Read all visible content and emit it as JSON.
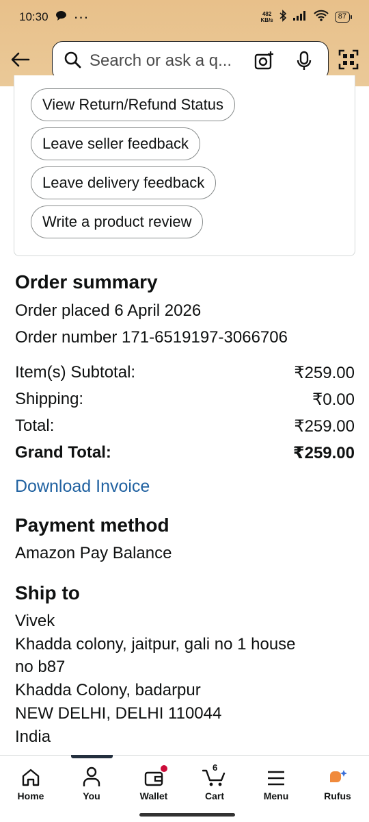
{
  "status_bar": {
    "time": "10:30",
    "dots": "···",
    "net_speed_value": "482",
    "net_speed_unit": "KB/s",
    "battery": "87"
  },
  "search": {
    "placeholder": "Search or ask a q..."
  },
  "actions": [
    {
      "label": "View Return/Refund Status"
    },
    {
      "label": "Leave seller feedback"
    },
    {
      "label": "Leave delivery feedback"
    },
    {
      "label": "Write a product review"
    }
  ],
  "order_summary": {
    "title": "Order summary",
    "placed": "Order placed 6 April 2026",
    "number": "Order number 171-6519197-3066706",
    "rows": [
      {
        "label": "Item(s) Subtotal:",
        "value": "₹259.00"
      },
      {
        "label": "Shipping:",
        "value": "₹0.00"
      },
      {
        "label": "Total:",
        "value": "₹259.00"
      },
      {
        "label": "Grand Total:",
        "value": "₹259.00"
      }
    ],
    "invoice_link": "Download Invoice"
  },
  "payment": {
    "title": "Payment method",
    "method": "Amazon Pay Balance"
  },
  "ship_to": {
    "title": "Ship to",
    "lines": [
      "Vivek",
      "Khadda colony, jaitpur, gali no 1 house",
      "no b87",
      "Khadda Colony, badarpur",
      "NEW DELHI, DELHI 110044",
      "India"
    ]
  },
  "bottom_nav": {
    "cart_count": "6",
    "items": [
      {
        "label": "Home",
        "icon": "home-icon"
      },
      {
        "label": "You",
        "icon": "user-icon"
      },
      {
        "label": "Wallet",
        "icon": "wallet-icon"
      },
      {
        "label": "Cart",
        "icon": "cart-icon"
      },
      {
        "label": "Menu",
        "icon": "menu-icon"
      },
      {
        "label": "Rufus",
        "icon": "rufus-icon"
      }
    ]
  },
  "colors": {
    "header_bg": "#e8c08a",
    "link": "#2162a1",
    "badge_red": "#cc0c39",
    "rufus_orange": "#f08a3c",
    "rufus_blue": "#3a6fd8"
  }
}
